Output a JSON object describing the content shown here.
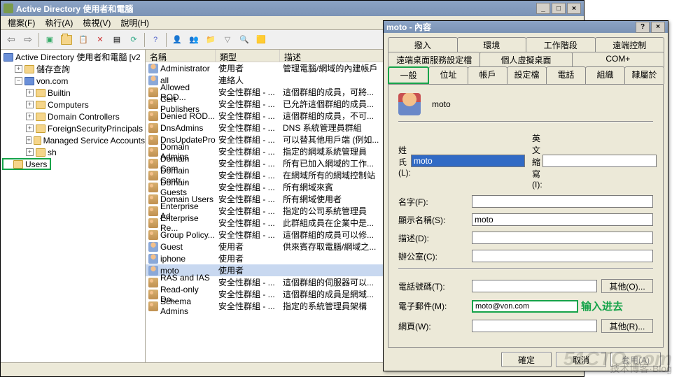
{
  "main_window": {
    "title": "Active Directory 使用者和電腦",
    "menu": {
      "file": "檔案(F)",
      "action": "執行(A)",
      "view": "檢視(V)",
      "help": "說明(H)"
    },
    "tree": {
      "root": "Active Directory 使用者和電腦 [v2",
      "saved": "儲存查詢",
      "domain": "von.com",
      "items": [
        "Builtin",
        "Computers",
        "Domain Controllers",
        "ForeignSecurityPrincipals",
        "Managed Service Accounts",
        "sh",
        "Users"
      ]
    },
    "list": {
      "headers": {
        "name": "名稱",
        "type": "類型",
        "desc": "描述"
      },
      "rows": [
        {
          "icon": "user",
          "name": "Administrator",
          "type": "使用者",
          "desc": "管理電腦/網域的內建帳戶"
        },
        {
          "icon": "user",
          "name": "all",
          "type": "連絡人",
          "desc": ""
        },
        {
          "icon": "group",
          "name": "Allowed ROD...",
          "type": "安全性群組 - ...",
          "desc": "這個群組的成員，可將..."
        },
        {
          "icon": "group",
          "name": "Cert Publishers",
          "type": "安全性群組 - ...",
          "desc": "已允許這個群組的成員..."
        },
        {
          "icon": "group",
          "name": "Denied ROD...",
          "type": "安全性群組 - ...",
          "desc": "這個群組的成員，不可..."
        },
        {
          "icon": "group",
          "name": "DnsAdmins",
          "type": "安全性群組 - ...",
          "desc": "DNS 系統管理員群組"
        },
        {
          "icon": "group",
          "name": "DnsUpdatePro...",
          "type": "安全性群組 - ...",
          "desc": "可以替其他用戶端 (例如..."
        },
        {
          "icon": "group",
          "name": "Domain Admins",
          "type": "安全性群組 - ...",
          "desc": "指定的網域系統管理員"
        },
        {
          "icon": "group",
          "name": "Domain Com...",
          "type": "安全性群組 - ...",
          "desc": "所有已加入網域的工作..."
        },
        {
          "icon": "group",
          "name": "Domain Contr...",
          "type": "安全性群組 - ...",
          "desc": "在網域所有的網域控制站"
        },
        {
          "icon": "group",
          "name": "Domain Guests",
          "type": "安全性群組 - ...",
          "desc": "所有網域來賓"
        },
        {
          "icon": "group",
          "name": "Domain Users",
          "type": "安全性群組 - ...",
          "desc": "所有網域使用者"
        },
        {
          "icon": "group",
          "name": "Enterprise Ad...",
          "type": "安全性群組 - ...",
          "desc": "指定的公司系統管理員"
        },
        {
          "icon": "group",
          "name": "Enterprise Re...",
          "type": "安全性群組 - ...",
          "desc": "此群組成員在企業中是..."
        },
        {
          "icon": "group",
          "name": "Group Policy...",
          "type": "安全性群組 - ...",
          "desc": "這個群組的成員可以修..."
        },
        {
          "icon": "user",
          "name": "Guest",
          "type": "使用者",
          "desc": "供來賓存取電腦/網域之..."
        },
        {
          "icon": "user",
          "name": "iphone",
          "type": "使用者",
          "desc": ""
        },
        {
          "icon": "user",
          "name": "moto",
          "type": "使用者",
          "desc": "",
          "selected": true
        },
        {
          "icon": "group",
          "name": "RAS and IAS ...",
          "type": "安全性群組 - ...",
          "desc": "這個群組的伺服器可以..."
        },
        {
          "icon": "group",
          "name": "Read-only Do...",
          "type": "安全性群組 - ...",
          "desc": "這個群組的成員是網域..."
        },
        {
          "icon": "group",
          "name": "Schema Admins",
          "type": "安全性群組 - ...",
          "desc": "指定的系統管理員架構"
        }
      ]
    }
  },
  "dialog": {
    "title": "moto - 內容",
    "tabs": {
      "r1": [
        "撥入",
        "環境",
        "工作階段",
        "遠端控制"
      ],
      "r2": [
        "遠端桌面服務設定檔",
        "個人虛擬桌面",
        "COM+"
      ],
      "r3": [
        "一般",
        "位址",
        "帳戶",
        "設定檔",
        "電話",
        "組織",
        "隸屬於"
      ]
    },
    "username": "moto",
    "fields": {
      "surname_label": "姓氏(L):",
      "surname": "moto",
      "initials_label": "英文縮寫(I):",
      "initials": "",
      "firstname_label": "名字(F):",
      "firstname": "",
      "displayname_label": "顯示名稱(S):",
      "displayname": "moto",
      "description_label": "描述(D):",
      "description": "",
      "office_label": "辦公室(C):",
      "office": "",
      "phone_label": "電話號碼(T):",
      "phone": "",
      "phone_other": "其他(O)...",
      "email_label": "電子郵件(M):",
      "email": "moto@von.com",
      "web_label": "網頁(W):",
      "web": "",
      "web_other": "其他(R)..."
    },
    "annotation": "输入进去",
    "buttons": {
      "ok": "確定",
      "cancel": "取消",
      "apply": "套用(A)"
    }
  },
  "watermark": "51CTO.com"
}
